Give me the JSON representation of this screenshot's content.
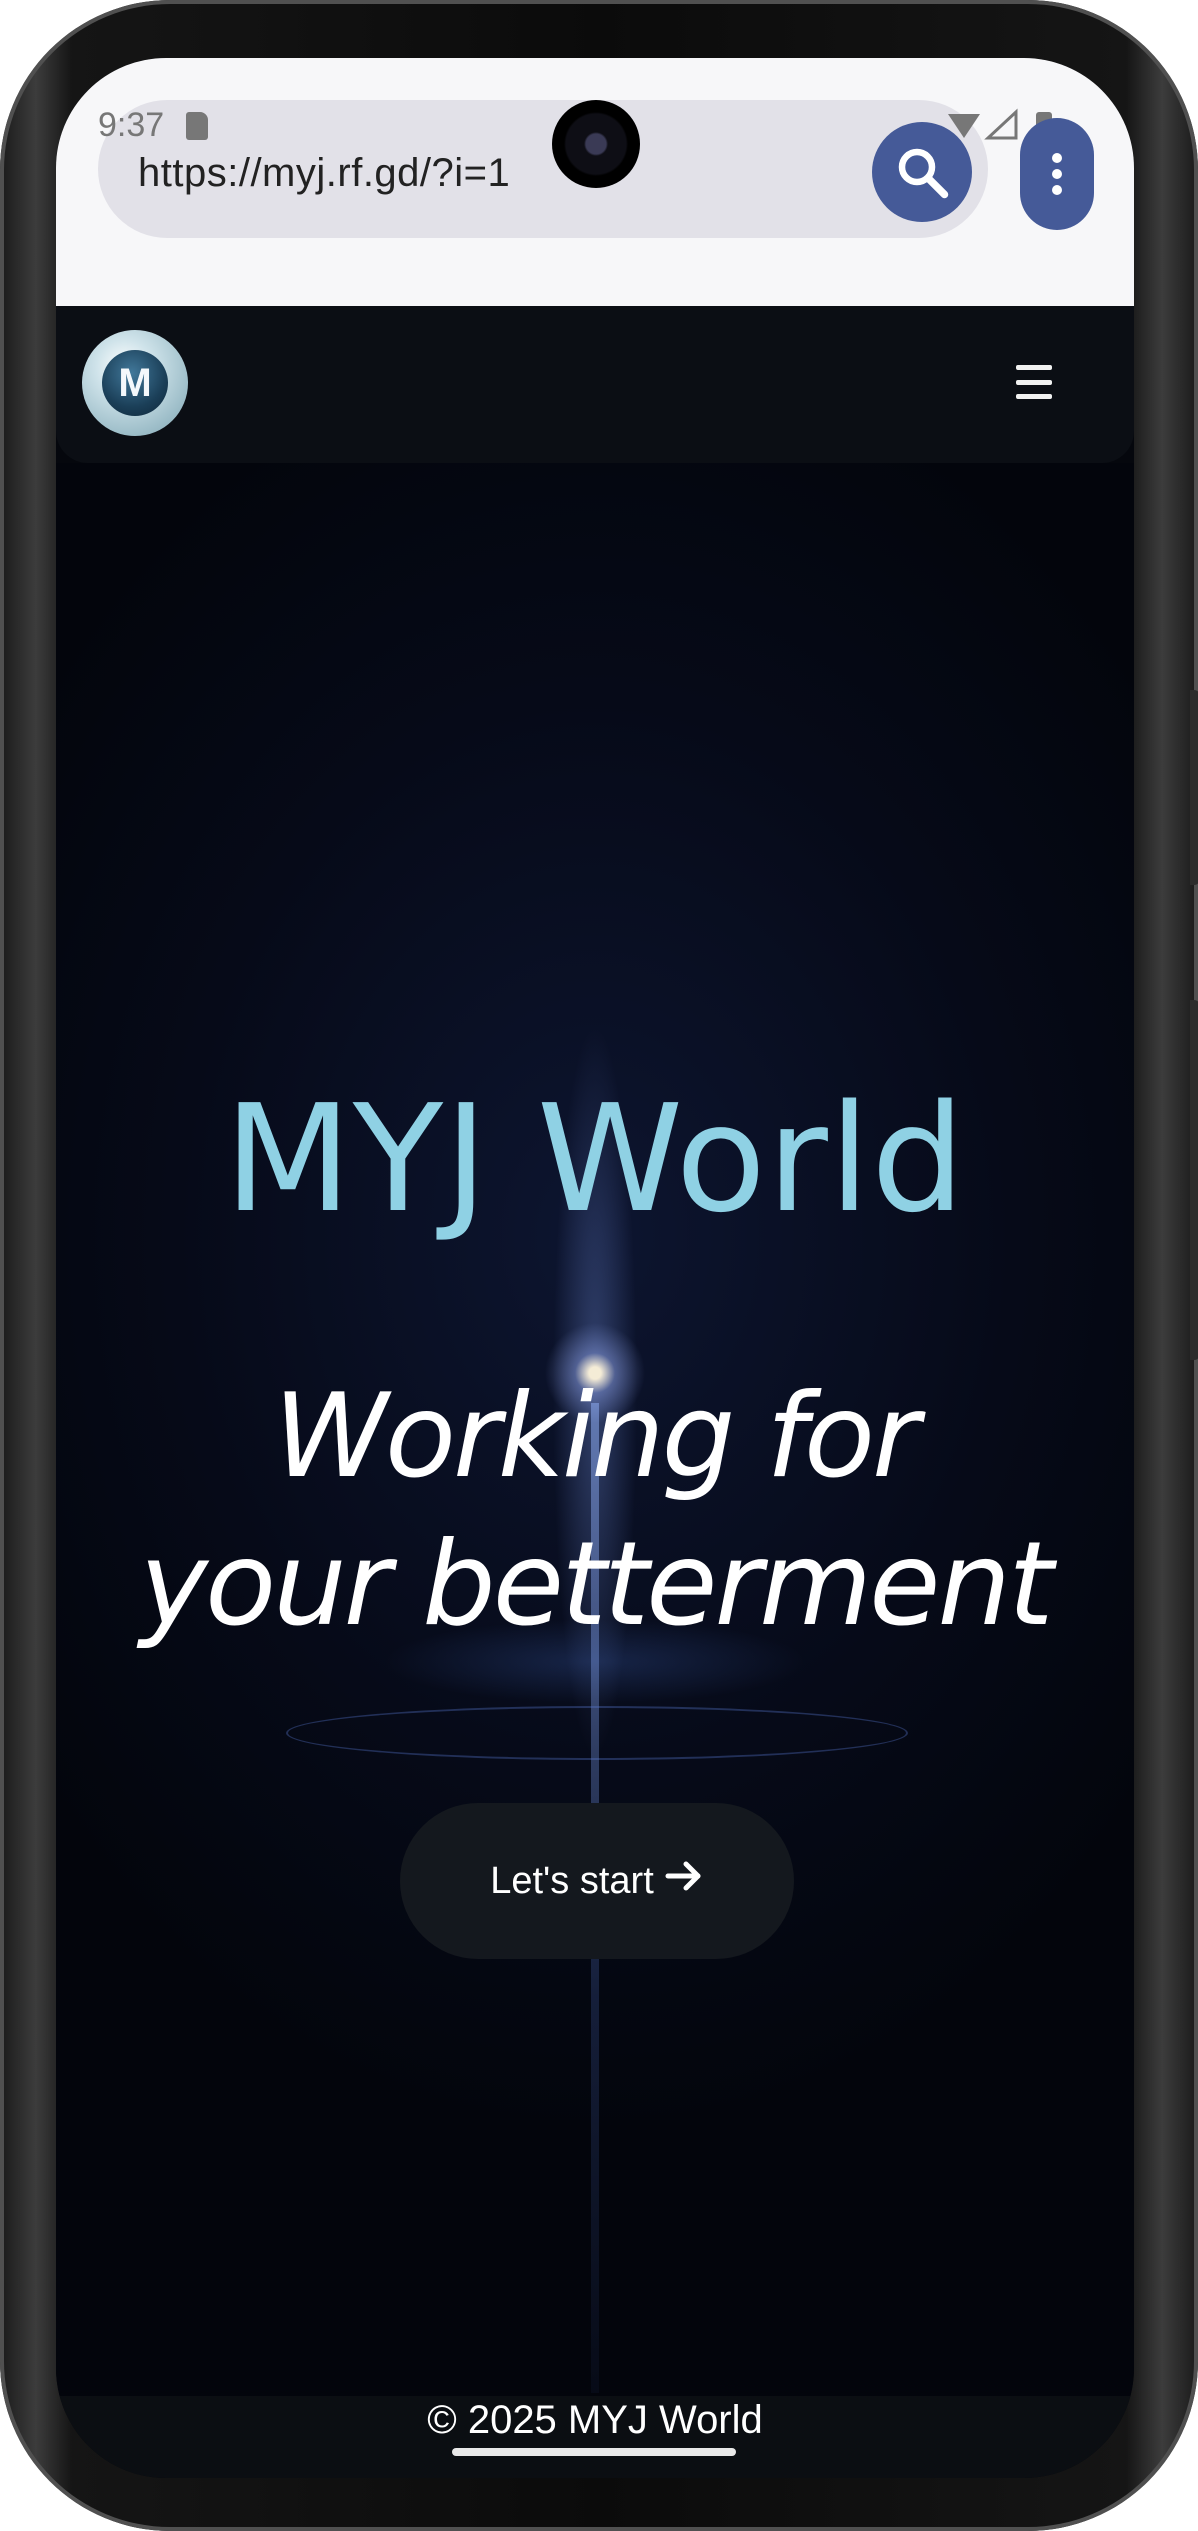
{
  "status_bar": {
    "time": "9:37"
  },
  "browser": {
    "url": "https://myj.rf.gd/?i=1",
    "search_icon": "search-icon",
    "menu_icon": "more-vert-icon"
  },
  "site_header": {
    "logo_letter": "M",
    "menu_icon": "hamburger-icon"
  },
  "hero": {
    "title": "MYJ World",
    "subtitle": "Working for your betterment",
    "cta_label": "Let's start",
    "cta_icon": "arrow-right-icon"
  },
  "footer": {
    "text": "© 2025 MYJ World"
  },
  "colors": {
    "title": "#8fd1e4",
    "browser_accent": "#455a98",
    "button_bg": "#14181e"
  }
}
